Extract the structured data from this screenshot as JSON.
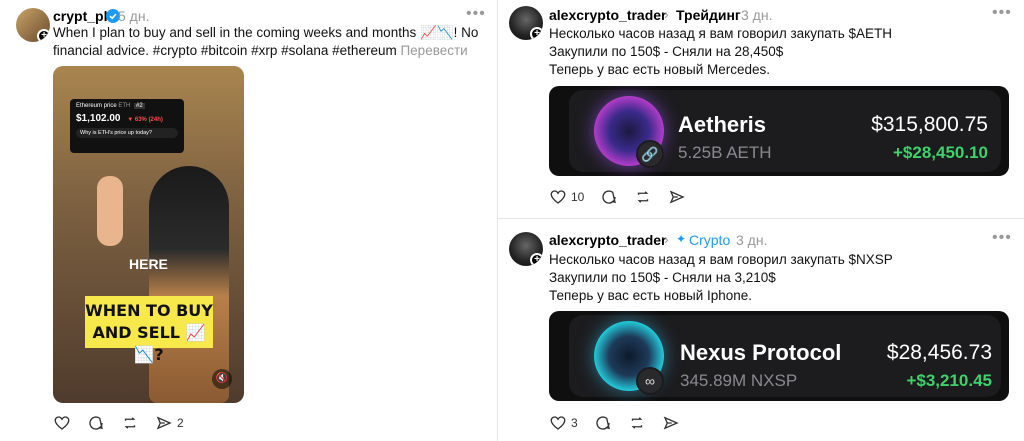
{
  "post1": {
    "username": "crypt_pl",
    "time": "5 дн.",
    "text": "When I plan to buy and sell in the coming weeks and months 📈📉! No financial advice. #crypto #bitcoin #xrp #solana #ethereum",
    "translate": "Перевести",
    "video": {
      "price_title": "Ethereum price",
      "price_ticker": "ETH",
      "price_tag": "#2",
      "price_value": "$1,102.00",
      "price_change": "▼ 63% (24h)",
      "price_question": "Why is ETH's price up today?",
      "here_text": "HERE",
      "overlay_text": "WHEN TO BUY AND SELL 📈📉?"
    },
    "actions": {
      "repost_count": "2"
    }
  },
  "post2": {
    "username": "alexcrypto_trader",
    "topic": "Трейдинг",
    "time": "3 дн.",
    "lines": [
      "Несколько часов назад я вам говорил закупать $AETH",
      "Закупили по 150$ - Сняли на 28,450$",
      "Теперь у вас есть новый Mercedes."
    ],
    "card": {
      "name": "Aetheris",
      "holdings": "5.25B AETH",
      "price": "$315,800.75",
      "gain": "+$28,450.10"
    },
    "actions": {
      "like_count": "10"
    }
  },
  "post3": {
    "username": "alexcrypto_trader",
    "topic": "Crypto",
    "time": "3 дн.",
    "lines": [
      "Несколько часов назад я вам говорил закупать $NXSP",
      "Закупили по 150$ - Сняли на 3,210$",
      "Теперь у вас есть новый Iphone."
    ],
    "card": {
      "name": "Nexus Protocol",
      "holdings": "345.89M NXSP",
      "price": "$28,456.73",
      "gain": "+$3,210.45"
    },
    "actions": {
      "like_count": "3"
    }
  },
  "icons": {
    "verified": "verified-badge-icon",
    "more": "more-icon",
    "like": "heart-icon",
    "comment": "comment-icon",
    "repost": "repost-icon",
    "share": "share-icon",
    "mute": "mute-icon",
    "link": "link-icon",
    "chevron": "chevron-right-icon"
  },
  "colors": {
    "verified": "#1d9bf0",
    "gain": "#3dd26b",
    "muted": "#999999",
    "card_bg": "#0f0f10"
  }
}
